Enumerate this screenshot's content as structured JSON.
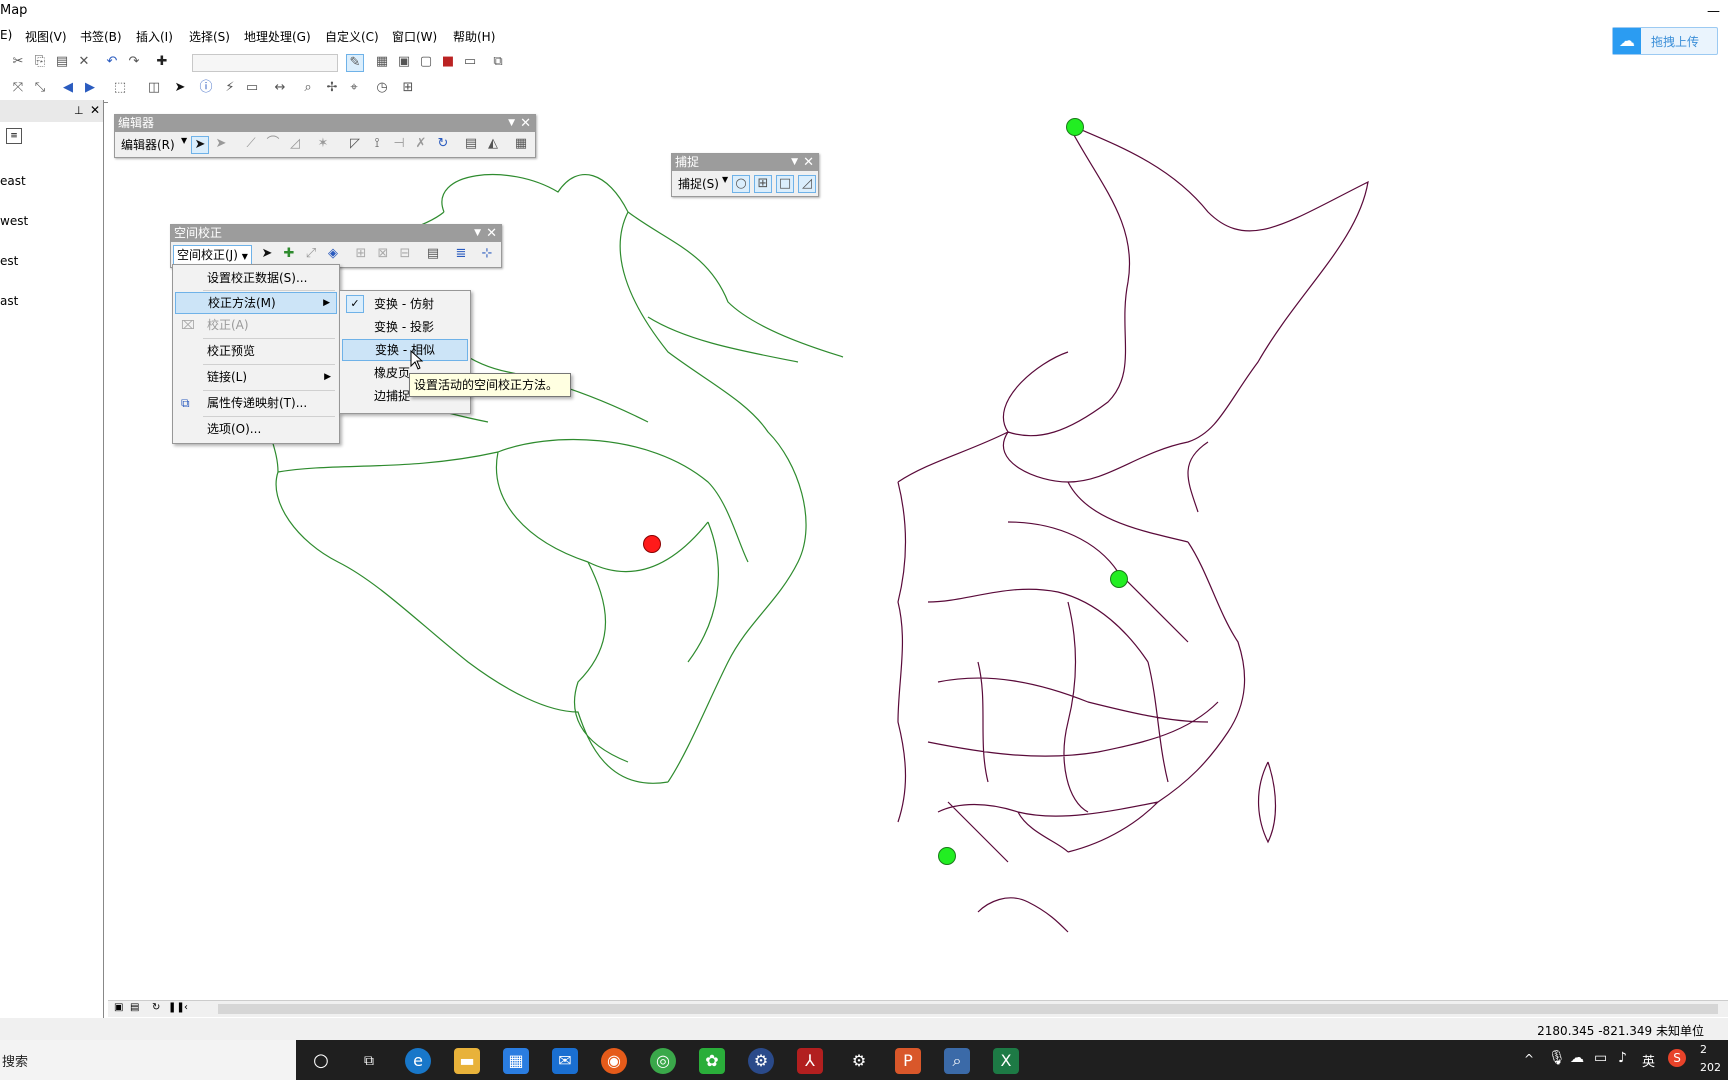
{
  "window": {
    "title": "Map"
  },
  "menubar": {
    "items": [
      "E)",
      "视图(V)",
      "书签(B)",
      "插入(I)",
      "选择(S)",
      "地理处理(G)",
      "自定义(C)",
      "窗口(W)",
      "帮助(H)"
    ]
  },
  "upload_button": {
    "label": "拖拽上传"
  },
  "toc": {
    "items": [
      "east",
      "west",
      "est",
      "ast"
    ]
  },
  "editor_toolbar": {
    "title": "编辑器",
    "menu_label": "编辑器(R)"
  },
  "snapping_toolbar": {
    "title": "捕捉",
    "menu_label": "捕捉(S)"
  },
  "spatial_adjust_toolbar": {
    "title": "空间校正",
    "menu_label": "空间校正(J)"
  },
  "adjust_menu": {
    "items": [
      {
        "label": "设置校正数据(S)..."
      },
      {
        "label": "校正方法(M)"
      },
      {
        "label": "校正(A)"
      },
      {
        "label": "校正预览"
      },
      {
        "label": "链接(L)"
      },
      {
        "label": "属性传递映射(T)..."
      },
      {
        "label": "选项(O)..."
      }
    ]
  },
  "method_submenu": {
    "items": [
      {
        "label": "变换 - 仿射",
        "checked": true
      },
      {
        "label": "变换 - 投影"
      },
      {
        "label": "变换 - 相似"
      },
      {
        "label": "橡皮页"
      },
      {
        "label": "边捕捉"
      }
    ]
  },
  "tooltip": {
    "text": "设置活动的空间校正方法。"
  },
  "status": {
    "coords": "2180.345  -821.349 未知单位"
  },
  "taskbar": {
    "search_text": "搜索",
    "ime": "英",
    "clock_top": "2",
    "clock_bottom": "202"
  },
  "colors": {
    "green_layer": "#2e8b2e",
    "purple_layer": "#5a0a3a",
    "source_point": "#ff1a1a",
    "target_point": "#22ee22",
    "highlight": "#cce4f7"
  }
}
